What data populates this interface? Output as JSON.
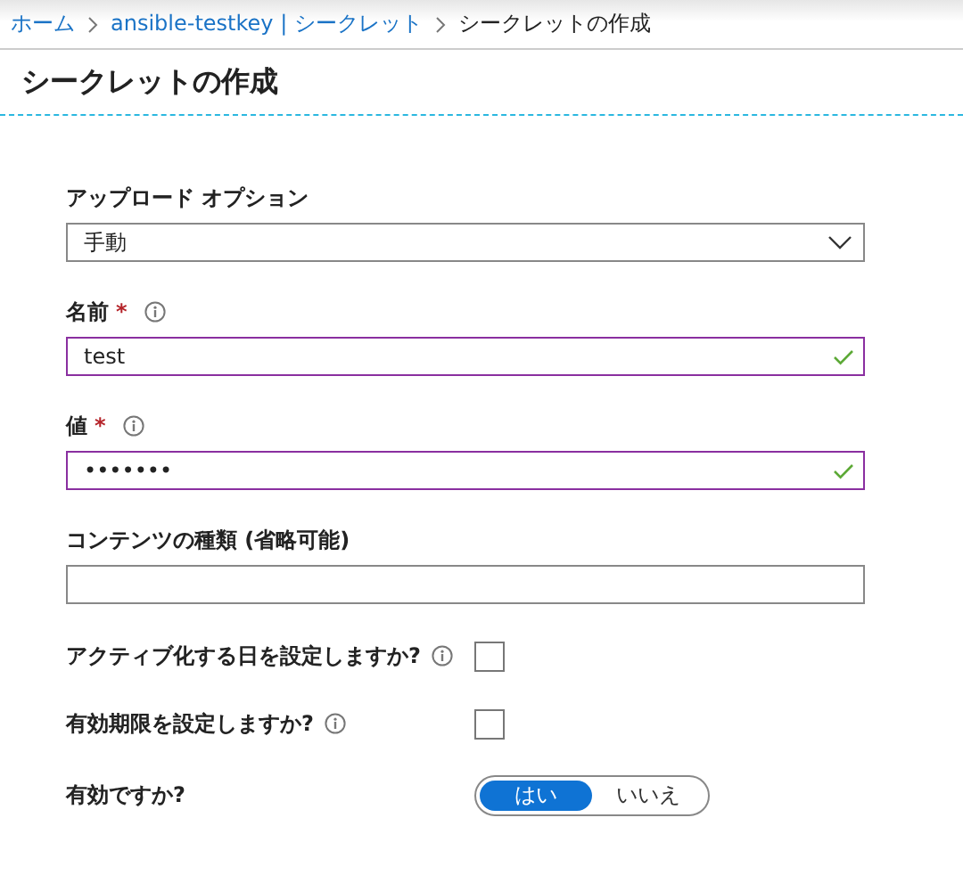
{
  "breadcrumb": [
    {
      "label": "ホーム",
      "link": true
    },
    {
      "label": "ansible-testkey | シークレット",
      "link": true
    },
    {
      "label": "シークレットの作成",
      "link": false
    }
  ],
  "title": "シークレットの作成",
  "fields": [
    {
      "kind": "select",
      "label": "アップロード オプション",
      "value": "手動"
    },
    {
      "kind": "text",
      "label": "名前",
      "required_mark": "*",
      "info": true,
      "value": "test",
      "valid": true
    },
    {
      "kind": "text",
      "label": "値",
      "required_mark": "*",
      "info": true,
      "value": "•••••••",
      "valid": true
    },
    {
      "kind": "text",
      "label": "コンテンツの種類 (省略可能)",
      "valid": false
    },
    {
      "kind": "checkbox",
      "label": "アクティブ化する日を設定しますか?",
      "info": true,
      "checked": false
    },
    {
      "kind": "checkbox",
      "label": "有効期限を設定しますか?",
      "info": true,
      "checked": false
    },
    {
      "kind": "toggle",
      "label": "有効ですか?",
      "options": [
        {
          "label": "はい",
          "selected": true
        },
        {
          "label": "いいえ",
          "selected": false
        }
      ]
    }
  ]
}
